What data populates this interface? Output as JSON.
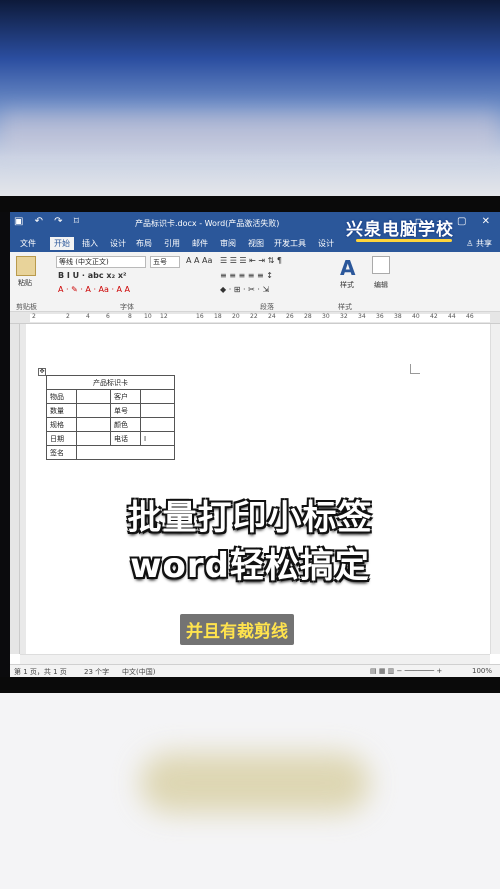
{
  "window": {
    "title": "产品标识卡.docx - Word(产品激活失败)",
    "watermark": "兴泉电脑学校"
  },
  "menu": {
    "tabs": [
      "文件",
      "开始",
      "插入",
      "设计",
      "布局",
      "引用",
      "邮件",
      "审阅",
      "视图",
      "开发工具",
      "设计"
    ],
    "active": "开始",
    "share": "共享"
  },
  "ribbon": {
    "paste_label": "粘贴",
    "font_name": "等线 (中文正文)",
    "font_size": "五号",
    "group_clipboard": "剪贴板",
    "group_font": "字体",
    "group_paragraph": "段落",
    "group_styles": "样式",
    "styles_label": "样式",
    "editing_label": "编辑"
  },
  "ruler": {
    "numbers": [
      "2",
      "2",
      "4",
      "6",
      "8",
      "10",
      "12",
      "16",
      "18",
      "20",
      "22",
      "24",
      "26",
      "28",
      "30",
      "32",
      "34",
      "36",
      "38",
      "40",
      "42",
      "44",
      "46"
    ]
  },
  "card": {
    "title": "产品标识卡",
    "rows": [
      [
        "物品",
        "",
        "客户",
        ""
      ],
      [
        "数量",
        "",
        "单号",
        ""
      ],
      [
        "规格",
        "",
        "颜色",
        ""
      ],
      [
        "日期",
        "",
        "电话",
        ""
      ]
    ],
    "sign": "签名"
  },
  "status": {
    "page": "第 1 页，共 1 页",
    "words": "23 个字",
    "language": "中文(中国)",
    "zoom": "100%"
  },
  "overlay": {
    "line1": "批量打印小标签",
    "line2": "word轻松搞定",
    "subtitle": "并且有裁剪线"
  },
  "colors": {
    "word_blue": "#2b579a",
    "subtitle_yellow": "#ffe34d"
  }
}
